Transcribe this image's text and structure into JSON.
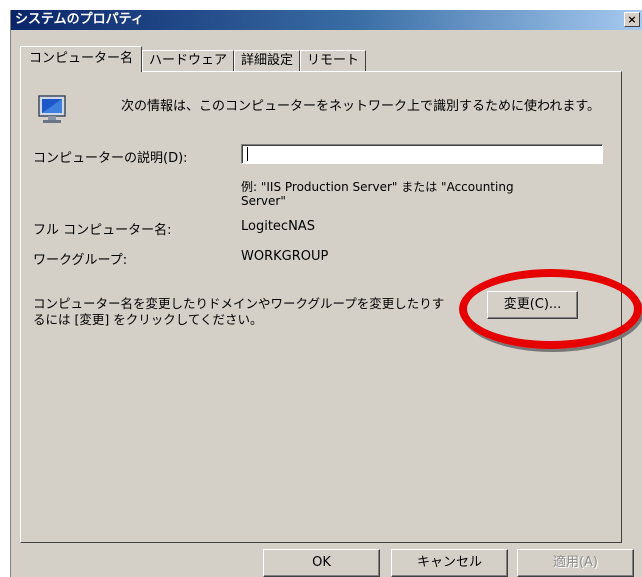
{
  "window": {
    "title": "システムのプロパティ",
    "close_label": "×"
  },
  "tabs": [
    {
      "label": "コンピューター名",
      "active": true
    },
    {
      "label": "ハードウェア",
      "active": false
    },
    {
      "label": "詳細設定",
      "active": false
    },
    {
      "label": "リモート",
      "active": false
    }
  ],
  "intro": {
    "icon": "computer-monitor-icon",
    "text": "次の情報は、このコンピューターをネットワーク上で識別するために使われます。"
  },
  "description": {
    "label": "コンピューターの説明(D):",
    "value": "",
    "example_line1": "例: \"IIS Production Server\" または \"Accounting",
    "example_line2": "Server\""
  },
  "full_name": {
    "label": "フル コンピューター名:",
    "value": "LogitecNAS"
  },
  "workgroup": {
    "label": "ワークグループ:",
    "value": "WORKGROUP"
  },
  "change": {
    "text_line1": "コンピューター名を変更したりドメインやワークグループを変更したりす",
    "text_line2": "るには [変更] をクリックしてください。",
    "button_label": "変更(C)..."
  },
  "buttons": {
    "ok": "OK",
    "cancel": "キャンセル",
    "apply": "適用(A)"
  },
  "colors": {
    "dialog_bg": "#d4d0c8",
    "titlebar": "#0a246a",
    "highlight": "#e60000"
  }
}
